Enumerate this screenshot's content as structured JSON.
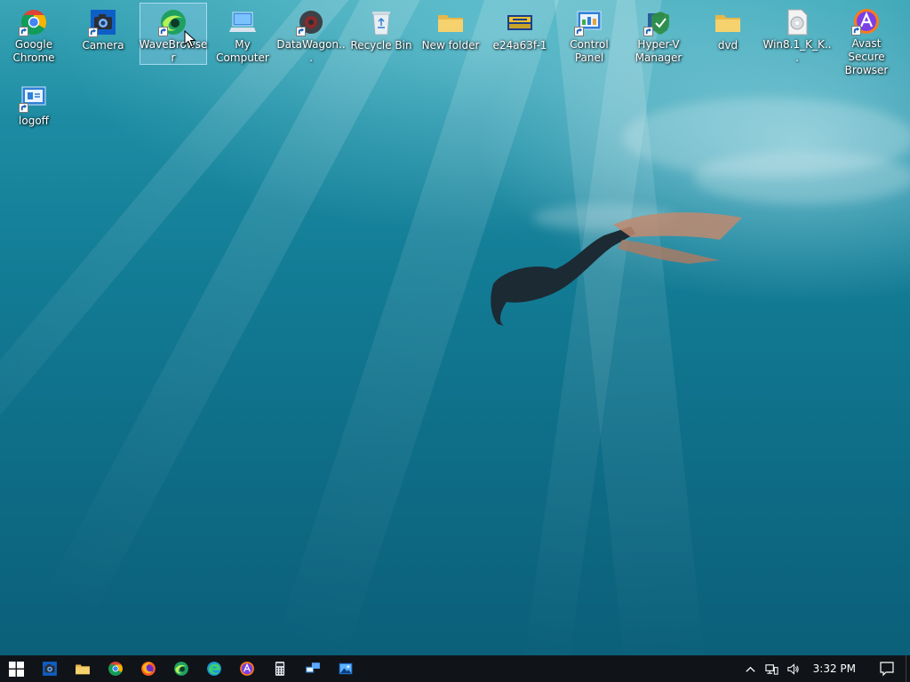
{
  "desktop": {
    "icons": [
      {
        "label": "Google\nChrome",
        "icon": "chrome-icon",
        "shortcut": true
      },
      {
        "label": "Camera",
        "icon": "camera-icon",
        "shortcut": true
      },
      {
        "label": "WaveBrowser",
        "icon": "wavebrowser-icon",
        "shortcut": true,
        "selected": true
      },
      {
        "label": "My Computer",
        "icon": "computer-icon",
        "shortcut": false
      },
      {
        "label": "DataWagon...",
        "icon": "datawagon-icon",
        "shortcut": true
      },
      {
        "label": "Recycle Bin",
        "icon": "recycle-bin-icon",
        "shortcut": false
      },
      {
        "label": "New folder",
        "icon": "folder-icon",
        "shortcut": false
      },
      {
        "label": "e24a63f-1",
        "icon": "image-file-icon",
        "shortcut": false
      },
      {
        "label": "Control Panel",
        "icon": "control-panel-icon",
        "shortcut": true
      },
      {
        "label": "Hyper-V\nManager",
        "icon": "hyper-v-icon",
        "shortcut": true
      },
      {
        "label": "dvd",
        "icon": "folder-icon",
        "shortcut": false
      },
      {
        "label": "Win8.1_K_K...",
        "icon": "disc-image-icon",
        "shortcut": false
      },
      {
        "label": "Avast Secure\nBrowser",
        "icon": "avast-icon",
        "shortcut": true
      },
      {
        "label": "logoff",
        "icon": "logoff-icon",
        "shortcut": true
      }
    ]
  },
  "taskbar": {
    "pinned": [
      {
        "name": "camera",
        "icon": "camera-icon"
      },
      {
        "name": "file-explorer",
        "icon": "folder-icon"
      },
      {
        "name": "chrome",
        "icon": "chrome-icon"
      },
      {
        "name": "firefox",
        "icon": "firefox-icon"
      },
      {
        "name": "wavebrowser",
        "icon": "wavebrowser-icon"
      },
      {
        "name": "edge",
        "icon": "edge-icon"
      },
      {
        "name": "avast-browser",
        "icon": "avast-icon"
      },
      {
        "name": "calculator",
        "icon": "calculator-icon"
      },
      {
        "name": "remote-desktop",
        "icon": "remote-desktop-icon"
      },
      {
        "name": "photos",
        "icon": "photos-icon"
      }
    ],
    "clock": "3:32 PM"
  },
  "colors": {
    "taskbar_bg": "#101418",
    "selection": "#a0d2f0"
  }
}
